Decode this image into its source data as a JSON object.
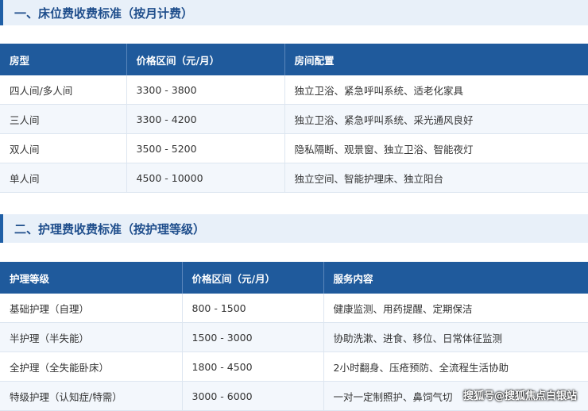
{
  "section1": {
    "title": "一、床位费收费标准（按月计费）",
    "headers": [
      "房型",
      "价格区间（元/月）",
      "房间配置"
    ],
    "rows": [
      [
        "四人间/多人间",
        "3300 - 3800",
        "独立卫浴、紧急呼叫系统、适老化家具"
      ],
      [
        "三人间",
        "3300 - 4200",
        "独立卫浴、紧急呼叫系统、采光通风良好"
      ],
      [
        "双人间",
        "3500 - 5200",
        "隐私隔断、观景窗、独立卫浴、智能夜灯"
      ],
      [
        "单人间",
        "4500 - 10000",
        "独立空间、智能护理床、独立阳台"
      ]
    ]
  },
  "section2": {
    "title": "二、护理费收费标准（按护理等级）",
    "headers": [
      "护理等级",
      "价格区间（元/月）",
      "服务内容"
    ],
    "rows": [
      [
        "基础护理（自理）",
        "800 - 1500",
        "健康监测、用药提醒、定期保洁"
      ],
      [
        "半护理（半失能）",
        "1500 - 3000",
        "协助洗漱、进食、移位、日常体征监测"
      ],
      [
        "全护理（全失能卧床）",
        "1800 - 4500",
        "2小时翻身、压疮预防、全流程生活协助"
      ],
      [
        "特级护理（认知症/特需）",
        "3000 - 6000",
        "一对一定制照护、鼻饲气切"
      ]
    ]
  },
  "watermark": "搜狐号@搜狐焦点白银站"
}
